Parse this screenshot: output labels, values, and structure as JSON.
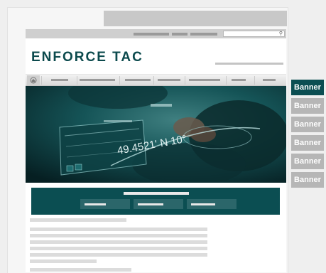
{
  "brand": {
    "logo_text": "ENFORCE TAC"
  },
  "hero": {
    "overlay_text": "49.4521' N 10°"
  },
  "banners": [
    {
      "label": "Banner",
      "active": true
    },
    {
      "label": "Banner",
      "active": false
    },
    {
      "label": "Banner",
      "active": false
    },
    {
      "label": "Banner",
      "active": false
    },
    {
      "label": "Banner",
      "active": false
    },
    {
      "label": "Banner",
      "active": false
    }
  ],
  "colors": {
    "brand_teal": "#0b4e52",
    "banner_inactive": "#b6b6b6",
    "placeholder_grey": "#dcdcdc"
  },
  "icons": {
    "home": "home-icon",
    "search": "search-icon"
  }
}
